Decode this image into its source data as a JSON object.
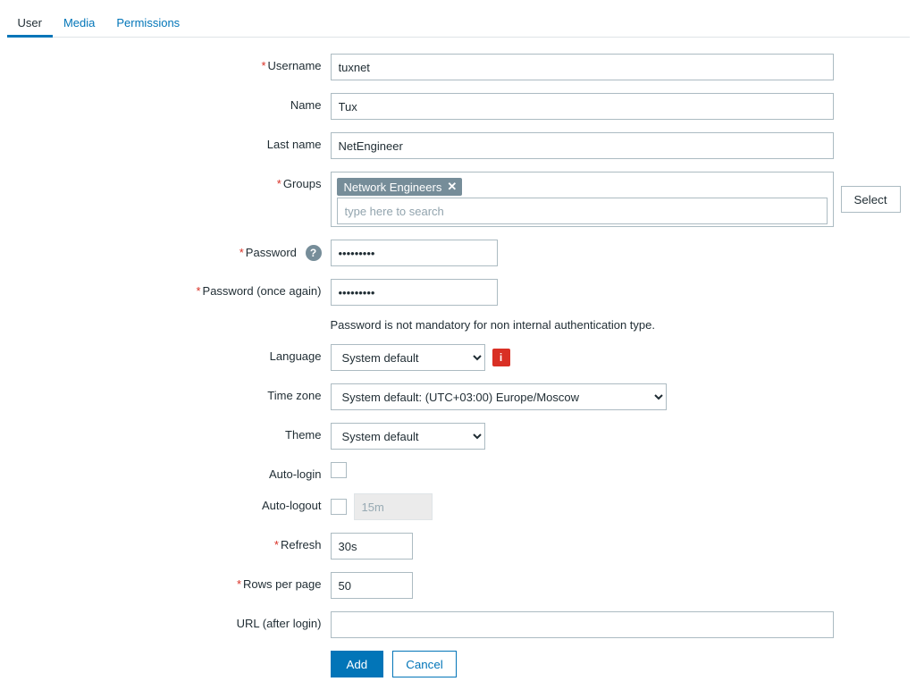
{
  "tabs": {
    "user": "User",
    "media": "Media",
    "permissions": "Permissions"
  },
  "labels": {
    "username": "Username",
    "name": "Name",
    "lastname": "Last name",
    "groups": "Groups",
    "password": "Password",
    "password2": "Password (once again)",
    "language": "Language",
    "timezone": "Time zone",
    "theme": "Theme",
    "autologin": "Auto-login",
    "autologout": "Auto-logout",
    "refresh": "Refresh",
    "rows": "Rows per page",
    "url": "URL (after login)"
  },
  "values": {
    "username": "tuxnet",
    "name": "Tux",
    "lastname": "NetEngineer",
    "group_tag": "Network Engineers",
    "groups_placeholder": "type here to search",
    "select_btn": "Select",
    "password": "•••••••••",
    "password2": "•••••••••",
    "password_hint": "Password is not mandatory for non internal authentication type.",
    "language": "System default",
    "timezone": "System default: (UTC+03:00) Europe/Moscow",
    "theme": "System default",
    "autologout_value": "15m",
    "refresh": "30s",
    "rows": "50",
    "url": ""
  },
  "actions": {
    "add": "Add",
    "cancel": "Cancel"
  }
}
